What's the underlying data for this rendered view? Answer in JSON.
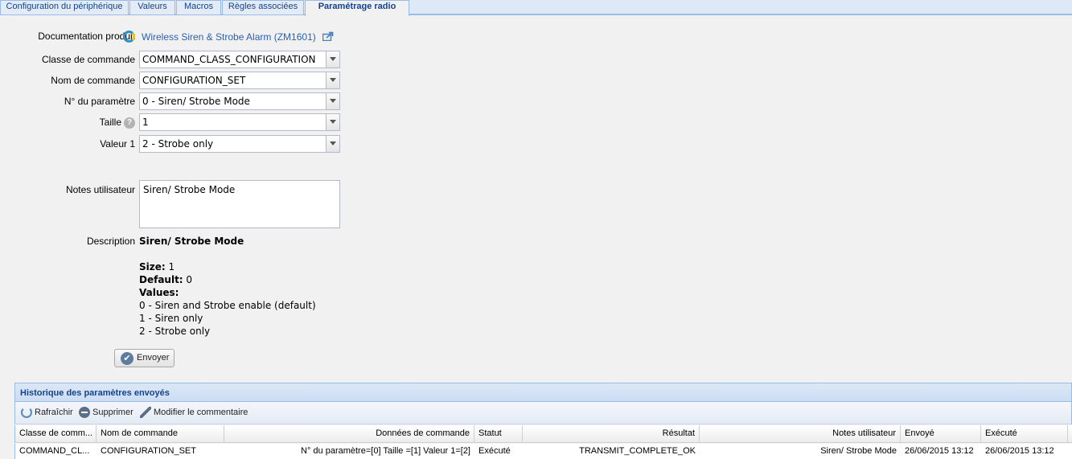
{
  "tabs": [
    {
      "label": "Configuration du périphérique",
      "active": false
    },
    {
      "label": "Valeurs",
      "active": false
    },
    {
      "label": "Macros",
      "active": false
    },
    {
      "label": "Règles associées",
      "active": false
    },
    {
      "label": "Paramétrage radio",
      "active": true
    }
  ],
  "form": {
    "doc_label": "Documentation produit",
    "doc_link": "Wireless Siren & Strobe Alarm (ZM1601)",
    "class_label": "Classe de commande",
    "class_value": "COMMAND_CLASS_CONFIGURATION",
    "command_label": "Nom de commande",
    "command_value": "CONFIGURATION_SET",
    "param_label": "N° du paramètre",
    "param_value": "0 - Siren/ Strobe Mode",
    "size_label": "Taille",
    "size_help": "?",
    "size_value": "1",
    "value1_label": "Valeur 1",
    "value1_value": "2 - Strobe only",
    "notes_label": "Notes utilisateur",
    "notes_value": "Siren/ Strobe Mode",
    "desc_label": "Description",
    "desc_title": "Siren/ Strobe Mode",
    "desc_size_key": "Size:",
    "desc_size_val": " 1",
    "desc_default_key": "Default:",
    "desc_default_val": " 0",
    "desc_values_key": "Values:",
    "desc_values": [
      "0 - Siren and Strobe enable (default)",
      "1 - Siren only",
      "2 - Strobe only"
    ],
    "send_label": "Envoyer"
  },
  "history": {
    "title": "Historique des paramètres envoyés",
    "toolbar": {
      "refresh": "Rafraîchir",
      "delete": "Supprimer",
      "edit_comment": "Modifier le commentaire"
    },
    "columns": [
      "Classe de comm...",
      "Nom de commande",
      "Données de commande",
      "Statut",
      "Résultat",
      "Notes utilisateur",
      "Envoyé",
      "Exécuté"
    ],
    "rows": [
      [
        "COMMAND_CL...",
        "CONFIGURATION_SET",
        "N° du paramètre=[0] Taille =[1] Valeur 1=[2]",
        "Exécuté",
        "TRANSMIT_COMPLETE_OK",
        "Siren/ Strobe Mode",
        "26/06/2015 13:12",
        "26/06/2015 13:12"
      ]
    ]
  },
  "colors": {
    "link": "#2b60b3",
    "panel_title": "#15428b",
    "panel_border": "#99bbe8"
  }
}
